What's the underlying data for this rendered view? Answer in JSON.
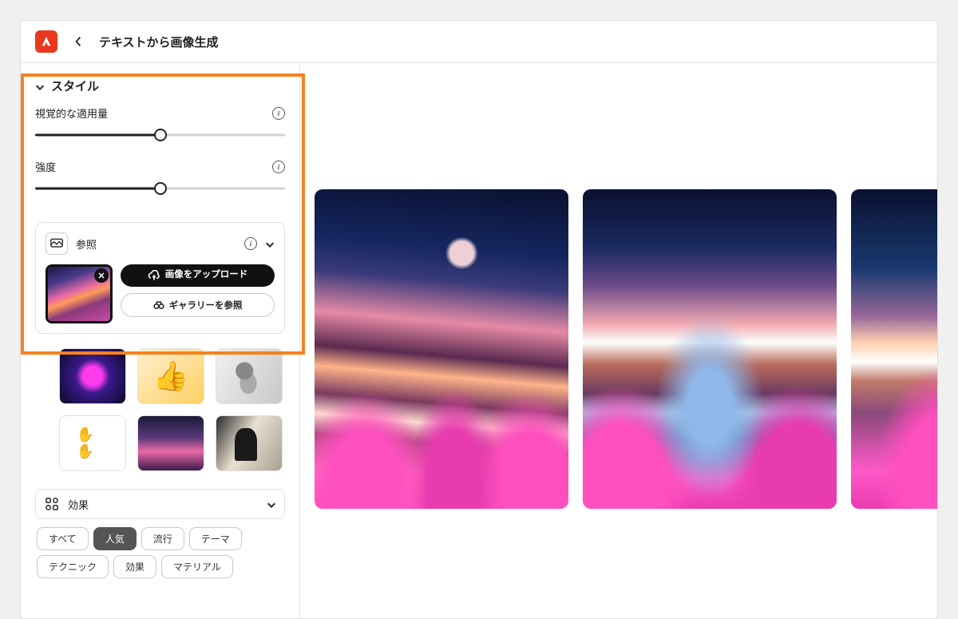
{
  "header": {
    "page_title": "テキストから画像生成"
  },
  "style_section": {
    "title": "スタイル",
    "slider1_label": "視覚的な適用量",
    "slider1_percent": 50,
    "slider2_label": "強度",
    "slider2_percent": 50
  },
  "reference": {
    "label": "参照",
    "upload_label": "画像をアップロード",
    "gallery_label": "ギャラリーを参照"
  },
  "effects": {
    "label": "効果",
    "chips": [
      {
        "label": "すべて",
        "active": false
      },
      {
        "label": "人気",
        "active": true
      },
      {
        "label": "流行",
        "active": false
      },
      {
        "label": "テーマ",
        "active": false
      },
      {
        "label": "テクニック",
        "active": false
      },
      {
        "label": "効果",
        "active": false
      },
      {
        "label": "マテリアル",
        "active": false
      }
    ]
  }
}
